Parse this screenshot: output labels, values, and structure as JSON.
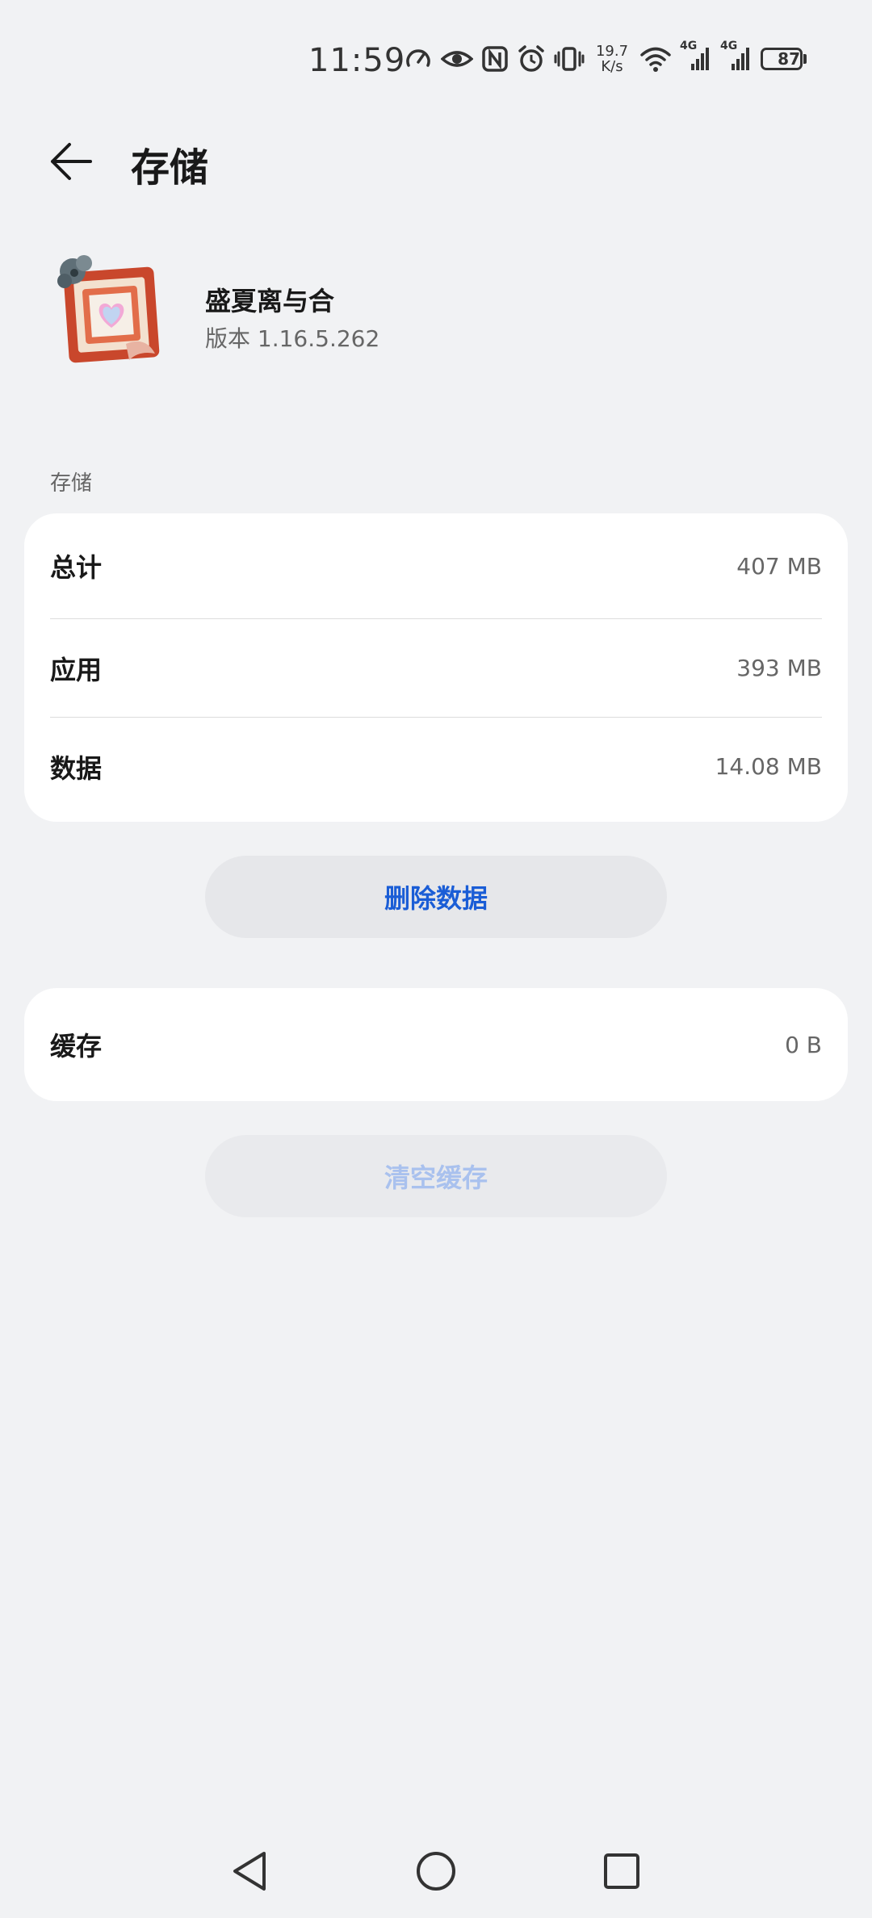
{
  "status_bar": {
    "time": "11:59",
    "net_speed_value": "19.7",
    "net_speed_unit": "K/s",
    "signal_1_label": "4G",
    "signal_2_label": "4G",
    "battery": "87",
    "icons": [
      "speedometer-icon",
      "eye-icon",
      "nfc-icon",
      "alarm-icon",
      "vibrate-icon",
      "wifi-icon",
      "cellular-signal-icon",
      "cellular-signal-icon",
      "battery-icon"
    ]
  },
  "header": {
    "title": "存储"
  },
  "app": {
    "name": "盛夏离与合",
    "version": "版本 1.16.5.262"
  },
  "storage_section": {
    "label": "存储",
    "rows": [
      {
        "label": "总计",
        "value": "407 MB"
      },
      {
        "label": "应用",
        "value": "393 MB"
      },
      {
        "label": "数据",
        "value": "14.08 MB"
      }
    ]
  },
  "buttons": {
    "delete_data": "删除数据",
    "clear_cache": "清空缓存"
  },
  "cache_section": {
    "label": "缓存",
    "value": "0 B"
  },
  "colors": {
    "accent": "#1a5dd6",
    "accent_disabled": "#a9c1ee",
    "background": "#f1f2f4",
    "card": "#ffffff"
  }
}
